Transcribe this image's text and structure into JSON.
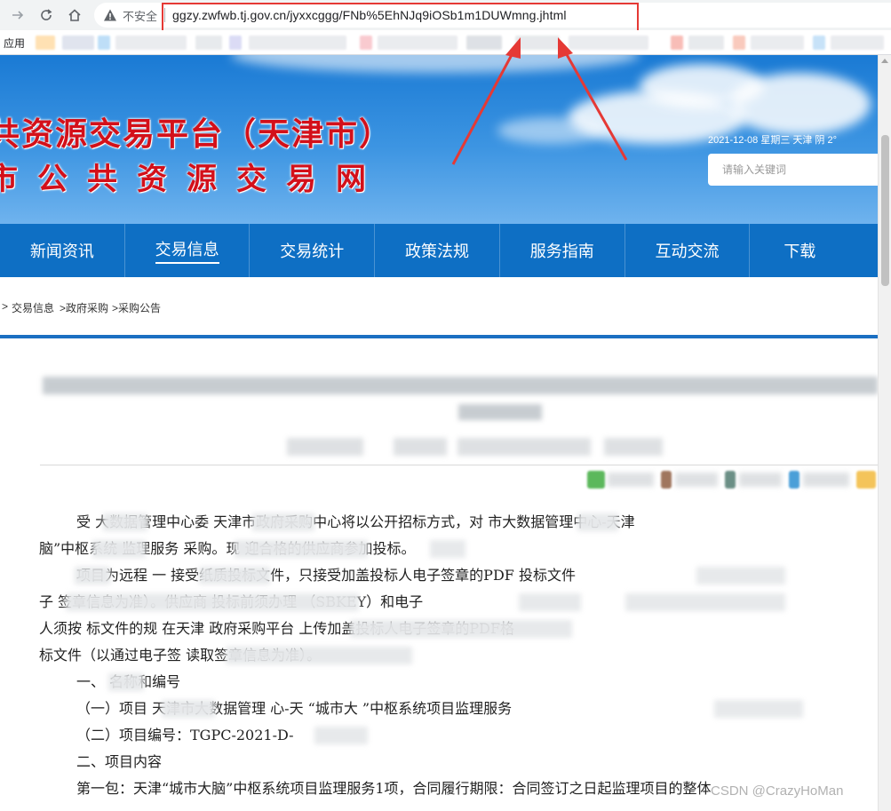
{
  "browser": {
    "insecure_label": "不安全",
    "url": "ggzy.zwfwb.tj.gov.cn/jyxxcggg/FNb%5EhNJq9iOSb1m1DUWmng.jhtml",
    "bookmarks_label": "应用",
    "icons": [
      "back-arrow-icon",
      "forward-arrow-icon",
      "refresh-icon",
      "home-icon",
      "warning-triangle-icon"
    ]
  },
  "banner": {
    "title_line1": "共资源交易平台（天津市）",
    "title_line2": "市公共资源交易网",
    "date_weather": "2021-12-08  星期三    天津  阴  2°",
    "search_placeholder": "请输入关键词"
  },
  "nav": {
    "items": [
      "新闻资讯",
      "交易信息",
      "交易统计",
      "政策法规",
      "服务指南",
      "互动交流",
      "下载"
    ],
    "active_index": 1
  },
  "breadcrumb": {
    "lead": ">",
    "items": [
      "交易信息",
      ">政府采购",
      ">采购公告"
    ]
  },
  "article": {
    "lines": [
      "受      大数据管理中心委      天津市政府采购中心将以公开招标方式，对      市大数据管理中心-天津",
      "脑”中枢系统      监理服务                采购。现      迎合格的供应商参加投标。",
      "项目为远程              一      接受纸质投标文件，只接受加盖投标人电子签章的PDF      投标文件",
      "子                                    签章信息为准）。供应商      投标前须办理                              （SBKEY）和电子",
      "人须按    标文件的规    在天津    政府采购平台                                  上传加盖投标人电子签章的PDF格",
      "标文件（以通过电子签                                      读取签章信息为准）。",
      "一、      名称和编号",
      "（一）项目      天津市大数据管理      心-天      “城市大      ”中枢系统项目监理服务",
      "（二）项目编号：TGPC-2021-D-     ",
      "二、项目内容",
      "第一包：天津“城市大脑”中枢系统项目监理服务1项，合同履行期限：合同签订之日起监理项目的整体"
    ]
  },
  "colors": {
    "nav_bg": "#0e6fc4",
    "title_red": "#d3101a",
    "rule_blue": "#1b6fc2",
    "highlight_red": "#e53935"
  },
  "watermark": "CSDN @CrazyHoMan"
}
